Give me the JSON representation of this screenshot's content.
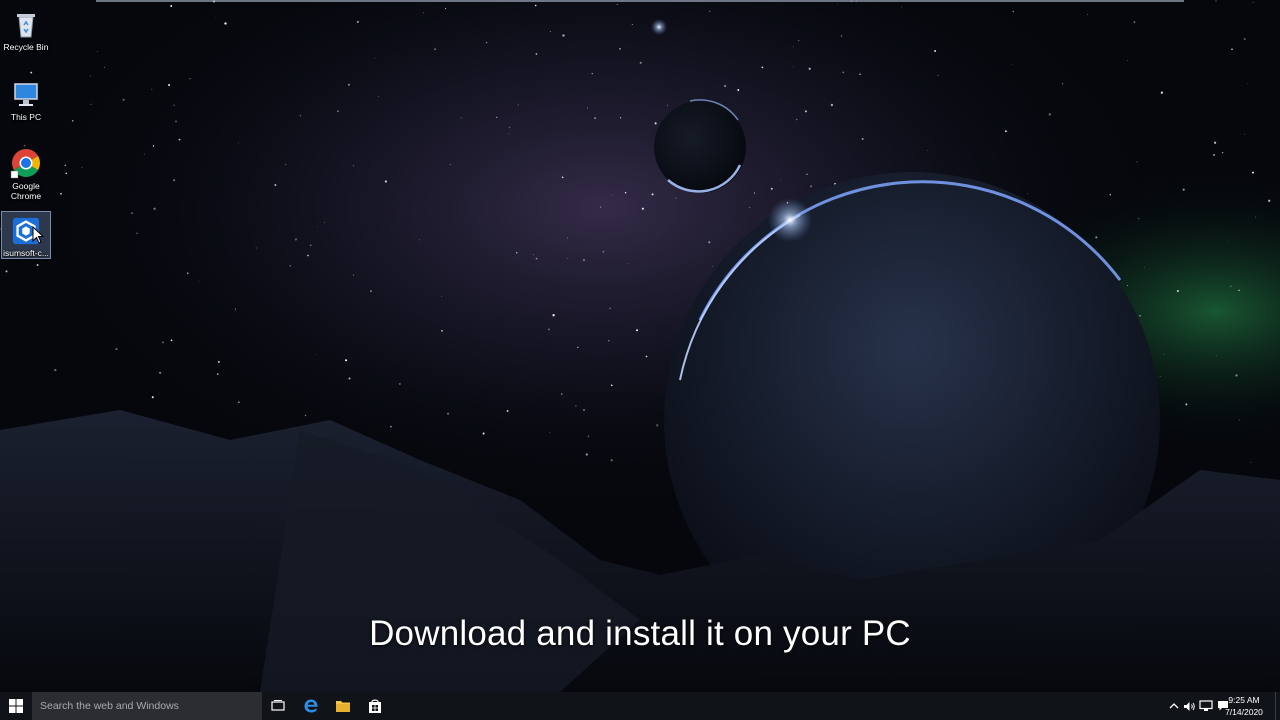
{
  "desktop": {
    "icons": [
      {
        "label": "Recycle Bin",
        "icon": "recycle-bin-icon"
      },
      {
        "label": "This PC",
        "icon": "computer-icon"
      },
      {
        "label": "Google Chrome",
        "icon": "chrome-icon"
      },
      {
        "label": "isumsoft-c...",
        "icon": "isumsoft-app-icon",
        "selected": true
      }
    ]
  },
  "subtitle": "Download and install it on your PC",
  "taskbar": {
    "search_placeholder": "Search the web and Windows",
    "pinned": [
      "task-view-icon",
      "edge-icon",
      "file-explorer-icon",
      "store-icon"
    ],
    "tray_icons": [
      "chevron-up-icon",
      "volume-icon",
      "network-icon",
      "action-center-icon"
    ],
    "time": "9:25 AM",
    "date": "7/14/2020"
  },
  "colors": {
    "taskbar_bg": "#101318",
    "search_bg": "#2b2d33",
    "accent_blue": "#1a73e8",
    "chrome_red": "#db4437",
    "chrome_yellow": "#f4b400",
    "chrome_green": "#0f9d58",
    "folder_yellow": "#f6c344"
  }
}
